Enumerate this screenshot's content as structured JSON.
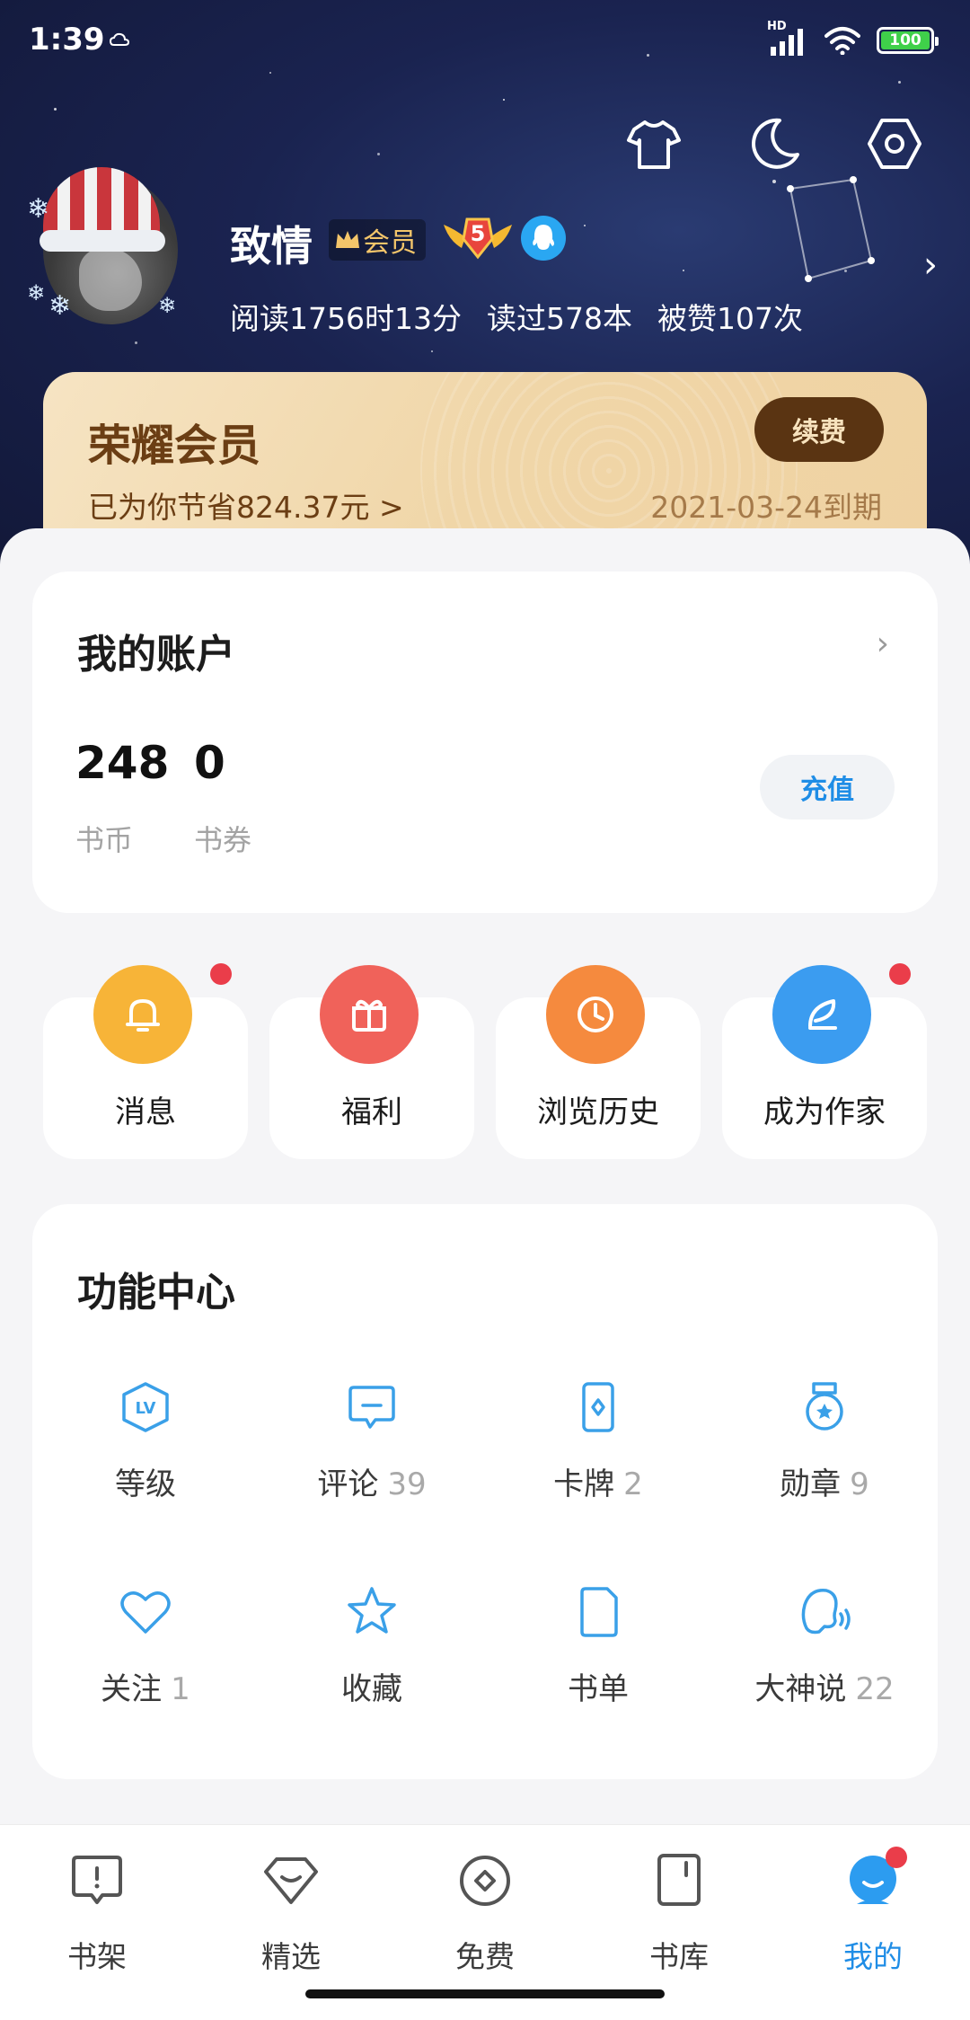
{
  "status_bar": {
    "time": "1:39",
    "network": "HD",
    "battery": "100"
  },
  "profile": {
    "username": "致情",
    "vip_tag": "会员",
    "level_badge": "5",
    "stats": [
      "阅读1756时13分",
      "读过578本",
      "被赞107次"
    ]
  },
  "vip_card": {
    "title": "荣耀会员",
    "savings": "已为你节省824.37元 >",
    "renew": "续费",
    "expire": "2021-03-24到期"
  },
  "account": {
    "title": "我的账户",
    "coins": "248",
    "coins_label": "书币",
    "vouchers": "0",
    "vouchers_label": "书券",
    "recharge": "充值"
  },
  "quick_actions": [
    {
      "label": "消息",
      "icon": "bell-icon",
      "color": "#f7b438",
      "badge": true
    },
    {
      "label": "福利",
      "icon": "gift-icon",
      "color": "#f0625a",
      "badge": false
    },
    {
      "label": "浏览历史",
      "icon": "clock-icon",
      "color": "#f58a3e",
      "badge": false
    },
    {
      "label": "成为作家",
      "icon": "quill-icon",
      "color": "#3b9cf0",
      "badge": true
    }
  ],
  "function_center": {
    "title": "功能中心",
    "items": [
      {
        "label": "等级",
        "count": "",
        "icon": "level-icon"
      },
      {
        "label": "评论",
        "count": "39",
        "icon": "comment-icon"
      },
      {
        "label": "卡牌",
        "count": "2",
        "icon": "card-icon"
      },
      {
        "label": "勋章",
        "count": "9",
        "icon": "medal-icon"
      },
      {
        "label": "关注",
        "count": "1",
        "icon": "heart-icon"
      },
      {
        "label": "收藏",
        "count": "",
        "icon": "star-icon"
      },
      {
        "label": "书单",
        "count": "",
        "icon": "booklist-icon"
      },
      {
        "label": "大神说",
        "count": "22",
        "icon": "speech-icon"
      }
    ]
  },
  "bottom_nav": [
    {
      "label": "书架",
      "icon": "bookshelf-icon"
    },
    {
      "label": "精选",
      "icon": "featured-icon"
    },
    {
      "label": "免费",
      "icon": "free-icon"
    },
    {
      "label": "书库",
      "icon": "library-icon"
    },
    {
      "label": "我的",
      "icon": "me-icon",
      "active": true
    }
  ],
  "colors": {
    "accent": "#1f8de6",
    "vip_brown": "#5a3412",
    "badge_red": "#ea3d4a"
  }
}
